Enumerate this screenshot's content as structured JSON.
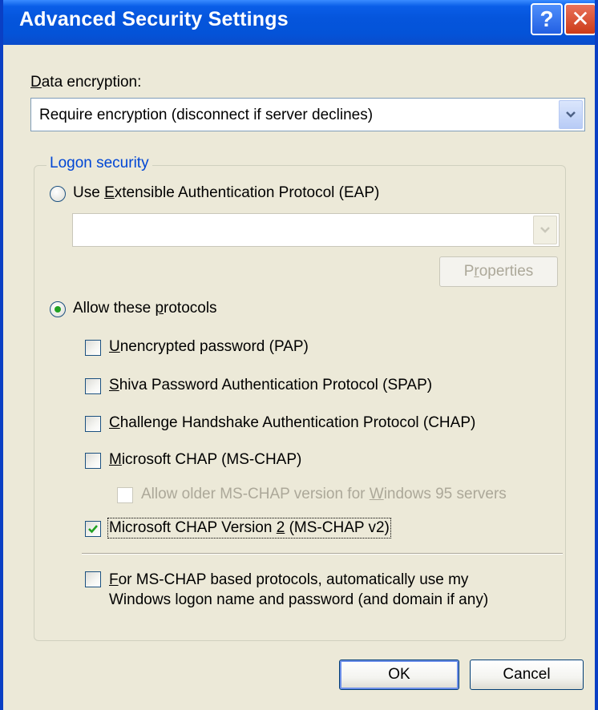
{
  "window": {
    "title": "Advanced Security Settings",
    "help_glyph": "?",
    "close_glyph": "✕"
  },
  "data_encryption": {
    "label_accel": "D",
    "label_rest": "ata encryption:",
    "selected": "Require encryption (disconnect if server declines)"
  },
  "logon_security": {
    "group_title": "Logon security",
    "eap": {
      "selected": false,
      "label_pre": "Use ",
      "label_accel": "E",
      "label_post": "xtensible Authentication Protocol (EAP)",
      "dropdown_value": "",
      "properties_pre": "P",
      "properties_accel": "r",
      "properties_post": "operties"
    },
    "allow": {
      "selected": true,
      "label_pre": "Allow these ",
      "label_accel": "p",
      "label_post": "rotocols"
    },
    "protocols": [
      {
        "checked": false,
        "enabled": true,
        "pre": "",
        "accel": "U",
        "post": "nencrypted password (PAP)"
      },
      {
        "checked": false,
        "enabled": true,
        "pre": "",
        "accel": "S",
        "post": "hiva Password Authentication Protocol (SPAP)"
      },
      {
        "checked": false,
        "enabled": true,
        "pre": "",
        "accel": "C",
        "post": "hallenge Handshake Authentication Protocol (CHAP)"
      },
      {
        "checked": false,
        "enabled": true,
        "pre": "",
        "accel": "M",
        "post": "icrosoft CHAP (MS-CHAP)"
      },
      {
        "checked": false,
        "enabled": false,
        "pre": "Allow older MS-CHAP version for ",
        "accel": "W",
        "post": "indows 95 servers"
      },
      {
        "checked": true,
        "enabled": true,
        "pre": "Microsoft CHAP Version ",
        "accel": "2",
        "post": " (MS-CHAP v2)"
      }
    ],
    "auto_logon": {
      "checked": false,
      "line1_accel": "F",
      "line1_rest": "or MS-CHAP based protocols, automatically use my",
      "line2": "Windows logon name and password (and domain if any)"
    }
  },
  "buttons": {
    "ok": "OK",
    "cancel": "Cancel"
  },
  "colors": {
    "title_bar": "#0555dc",
    "dialog_bg": "#ece9d8",
    "group_title": "#0046d5",
    "radio_dot": "#21a121",
    "check_mark": "#21a121",
    "disabled_text": "#aca899"
  }
}
